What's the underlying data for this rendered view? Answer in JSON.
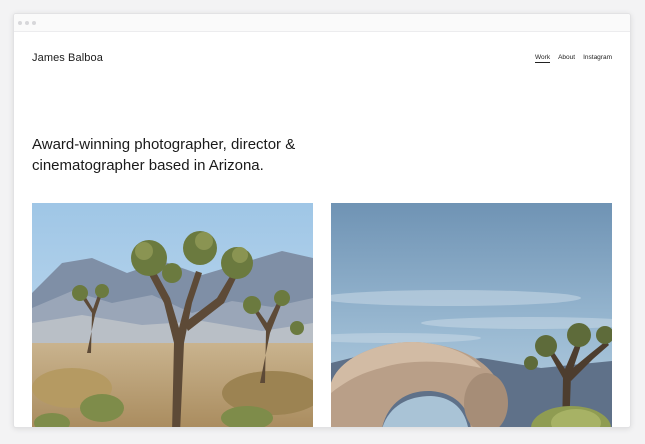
{
  "site": {
    "brand": "James Balboa"
  },
  "nav": {
    "items": [
      {
        "label": "Work"
      },
      {
        "label": "About"
      },
      {
        "label": "Instagram"
      }
    ]
  },
  "hero": {
    "headline": "Award-winning photographer, director & cinematographer based in Arizona."
  },
  "colors": {
    "background": "#ffffff",
    "text": "#1a1a1a"
  },
  "gallery": {
    "photos": [
      {
        "name": "joshua-tree-mountains"
      },
      {
        "name": "rock-arch-joshua-tree"
      }
    ]
  }
}
